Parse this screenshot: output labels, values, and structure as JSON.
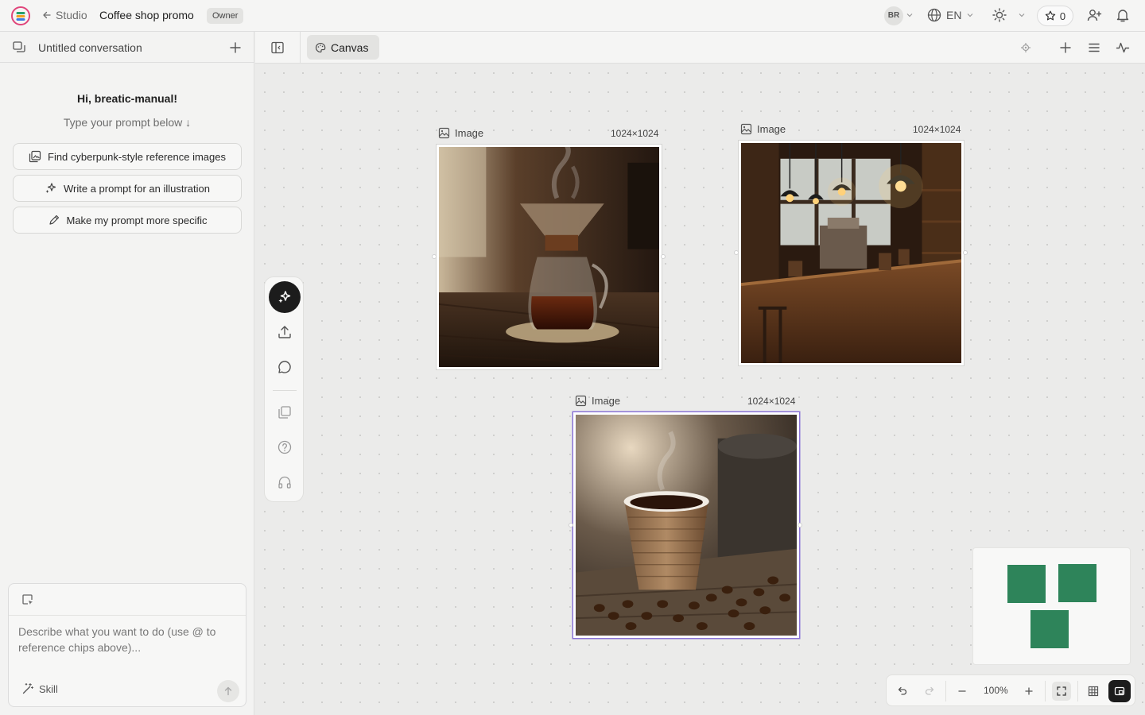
{
  "topbar": {
    "back_label": "Studio",
    "project_title": "Coffee shop promo",
    "role_badge": "Owner",
    "avatar_initials": "BR",
    "language": "EN",
    "credits": "0"
  },
  "sidebar": {
    "conversation_title": "Untitled conversation",
    "greeting": "Hi, breatic-manual!",
    "hint": "Type your prompt below ↓",
    "suggestions": [
      {
        "label": "Find cyberpunk-style reference images",
        "icon": "image-search-icon"
      },
      {
        "label": "Write a prompt for an illustration",
        "icon": "sparkles-icon"
      },
      {
        "label": "Make my prompt more specific",
        "icon": "pencil-icon"
      }
    ],
    "composer": {
      "placeholder": "Describe what you want to do (use @ to reference chips above)...",
      "skill_label": "Skill"
    }
  },
  "canvas": {
    "tab_label": "Canvas",
    "nodes": [
      {
        "label": "Image",
        "dims": "1024×1024",
        "subject": "pour-over coffee maker on wooden table",
        "selected": false
      },
      {
        "label": "Image",
        "dims": "1024×1024",
        "subject": "coffee shop interior with hanging lamps",
        "selected": false
      },
      {
        "label": "Image",
        "dims": "1024×1024",
        "subject": "paper coffee cup with coffee beans",
        "selected": true
      }
    ],
    "zoom_level": "100%"
  },
  "colors": {
    "accent_selection": "#8a73d6",
    "minimap_node": "#2e845a",
    "primary_button": "#1c1c1c"
  }
}
